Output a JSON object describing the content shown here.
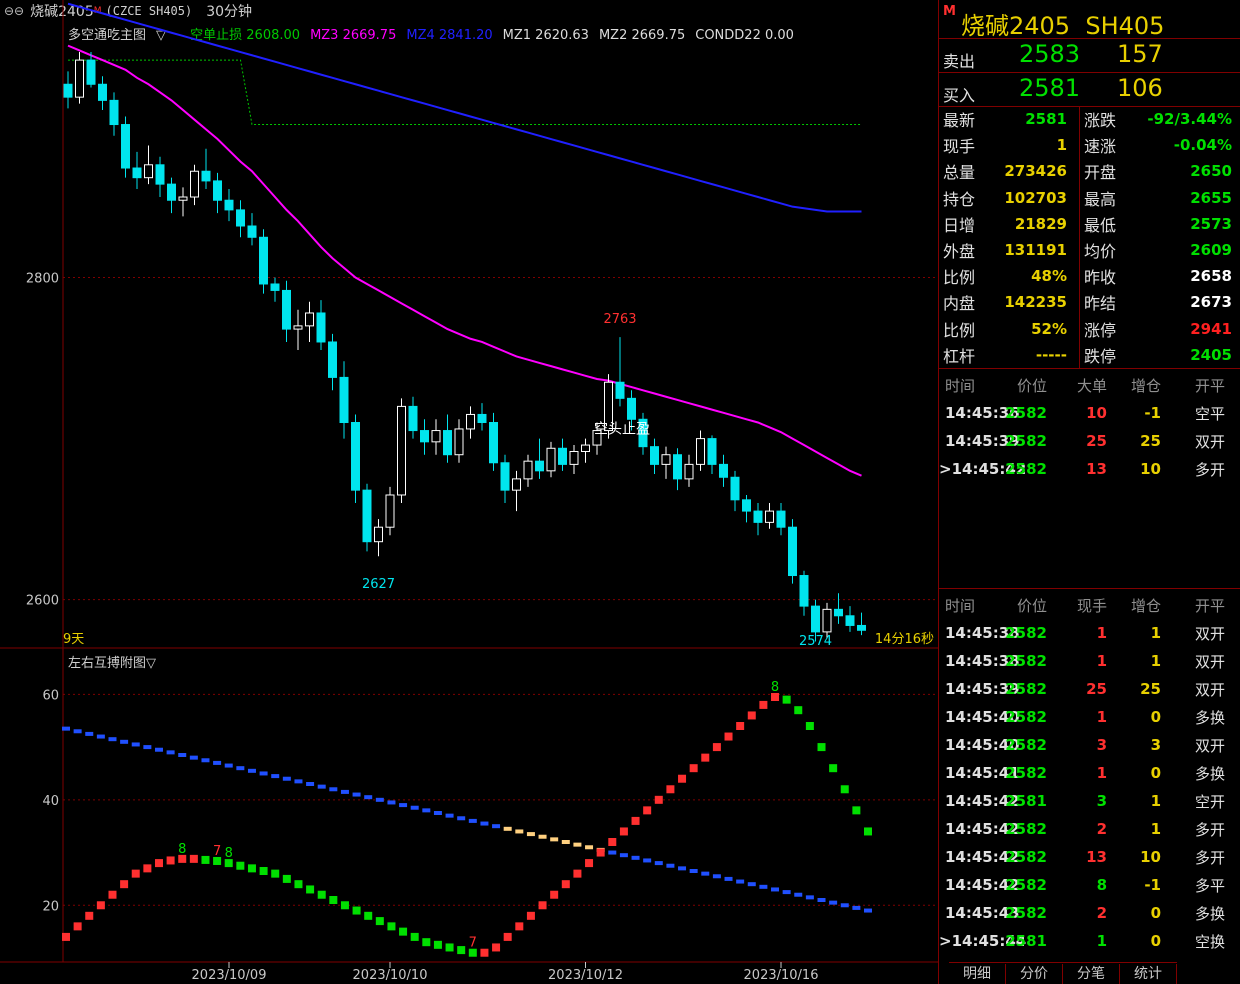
{
  "window": {
    "symbol": "烧碱2405",
    "flag": "M",
    "exchange": "(CZCE SH405)",
    "period": "30分钟"
  },
  "main": {
    "indicator_name": "多空通吃主图",
    "legend": [
      {
        "text": "空单止损 2608.00",
        "color": "#00c800"
      },
      {
        "text": "MZ3 2669.75",
        "color": "#ff00ff"
      },
      {
        "text": "MZ4 2841.20",
        "color": "#2020ff"
      },
      {
        "text": "MZ1 2620.63",
        "color": "#dcdcdc"
      },
      {
        "text": "MZ2 2669.75",
        "color": "#dcdcdc"
      },
      {
        "text": "CONDD22 0.00",
        "color": "#dcdcdc"
      }
    ],
    "y_ticks": [
      "2800",
      "2600"
    ],
    "label_high": "2763",
    "label_low1": "2627",
    "label_low2": "2574",
    "signal_text": "空头止盈",
    "bottom_left": "9天",
    "bottom_right": "14分16秒"
  },
  "sub": {
    "indicator_name": "左右互搏附图",
    "y_ticks": [
      "60",
      "40",
      "20"
    ],
    "markers": [
      "8",
      "7",
      "8",
      "7",
      "8"
    ]
  },
  "x_axis": [
    "2023/10/09",
    "2023/10/10",
    "2023/10/12",
    "2023/10/16"
  ],
  "quote": {
    "title": "烧碱2405  SH405",
    "flag": "M",
    "sell_label": "卖出",
    "sell_price": "2583",
    "sell_vol": "157",
    "buy_label": "买入",
    "buy_price": "2581",
    "buy_vol": "106",
    "left": [
      {
        "label": "最新",
        "value": "2581",
        "color": "#00e000"
      },
      {
        "label": "现手",
        "value": "1",
        "color": "#e8d000"
      },
      {
        "label": "总量",
        "value": "273426",
        "color": "#e8d000"
      },
      {
        "label": "持仓",
        "value": "102703",
        "color": "#e8d000"
      },
      {
        "label": "日增",
        "value": "21829",
        "color": "#e8d000"
      },
      {
        "label": "外盘",
        "value": "131191",
        "color": "#e8d000"
      },
      {
        "label": "比例",
        "value": "48%",
        "color": "#e8d000"
      },
      {
        "label": "内盘",
        "value": "142235",
        "color": "#e8d000"
      },
      {
        "label": "比例",
        "value": "52%",
        "color": "#e8d000"
      },
      {
        "label": "杠杆",
        "value": "-----",
        "color": "#e8d000"
      }
    ],
    "right": [
      {
        "label": "涨跌",
        "value": "-92/3.44%",
        "color": "#00e000"
      },
      {
        "label": "速涨",
        "value": "-0.04%",
        "color": "#00e000"
      },
      {
        "label": "开盘",
        "value": "2650",
        "color": "#00e000"
      },
      {
        "label": "最高",
        "value": "2655",
        "color": "#00e000"
      },
      {
        "label": "最低",
        "value": "2573",
        "color": "#00e000"
      },
      {
        "label": "均价",
        "value": "2609",
        "color": "#00e000"
      },
      {
        "label": "昨收",
        "value": "2658",
        "color": "#ffffff"
      },
      {
        "label": "昨结",
        "value": "2673",
        "color": "#ffffff"
      },
      {
        "label": "涨停",
        "value": "2941",
        "color": "#ff2020"
      },
      {
        "label": "跌停",
        "value": "2405",
        "color": "#00e000"
      }
    ]
  },
  "big_trades": {
    "headers": [
      "时间",
      "价位",
      "大单",
      "增仓",
      "开平"
    ],
    "rows": [
      {
        "mark": "",
        "time": "14:45:36",
        "price": "2582",
        "vol": "10",
        "chg": "-1",
        "type": "空平"
      },
      {
        "mark": "",
        "time": "14:45:39",
        "price": "2582",
        "vol": "25",
        "chg": "25",
        "type": "双开"
      },
      {
        "mark": ">",
        "time": "14:45:42",
        "price": "2582",
        "vol": "13",
        "chg": "10",
        "type": "多开"
      }
    ]
  },
  "ticks": {
    "headers": [
      "时间",
      "价位",
      "现手",
      "增仓",
      "开平"
    ],
    "rows": [
      {
        "mark": "",
        "time": "14:45:38",
        "price": "2582",
        "vol": "1",
        "vcol": "#ff3030",
        "chg": "1",
        "type": "双开"
      },
      {
        "mark": "",
        "time": "14:45:38",
        "price": "2582",
        "vol": "1",
        "vcol": "#ff3030",
        "chg": "1",
        "type": "双开"
      },
      {
        "mark": "",
        "time": "14:45:39",
        "price": "2582",
        "vol": "25",
        "vcol": "#ff3030",
        "chg": "25",
        "type": "双开"
      },
      {
        "mark": "",
        "time": "14:45:40",
        "price": "2582",
        "vol": "1",
        "vcol": "#ff3030",
        "chg": "0",
        "type": "多换"
      },
      {
        "mark": "",
        "time": "14:45:40",
        "price": "2582",
        "vol": "3",
        "vcol": "#ff3030",
        "chg": "3",
        "type": "双开"
      },
      {
        "mark": "",
        "time": "14:45:41",
        "price": "2582",
        "vol": "1",
        "vcol": "#ff3030",
        "chg": "0",
        "type": "多换"
      },
      {
        "mark": "",
        "time": "14:45:42",
        "price": "2581",
        "vol": "3",
        "vcol": "#00e000",
        "chg": "1",
        "type": "空开"
      },
      {
        "mark": "",
        "time": "14:45:42",
        "price": "2582",
        "vol": "2",
        "vcol": "#ff3030",
        "chg": "1",
        "type": "多开"
      },
      {
        "mark": "",
        "time": "14:45:42",
        "price": "2582",
        "vol": "13",
        "vcol": "#ff3030",
        "chg": "10",
        "type": "多开"
      },
      {
        "mark": "",
        "time": "14:45:42",
        "price": "2582",
        "vol": "8",
        "vcol": "#00e000",
        "chg": "-1",
        "type": "多平"
      },
      {
        "mark": "",
        "time": "14:45:43",
        "price": "2582",
        "vol": "2",
        "vcol": "#ff3030",
        "chg": "0",
        "type": "多换"
      },
      {
        "mark": ">",
        "time": "14:45:44",
        "price": "2581",
        "vol": "1",
        "vcol": "#00e000",
        "chg": "0",
        "type": "空换"
      }
    ]
  },
  "tabs": [
    "明细",
    "分价",
    "分笔",
    "统计"
  ],
  "colors": {
    "up": "#ffffff",
    "down": "#00e5ee",
    "mz3": "#ff00ff",
    "mz4": "#2020ff",
    "stop": "#00c800",
    "grid": "#800000",
    "red": "#ff3030",
    "green": "#00e000",
    "blue": "#2050ff",
    "orange": "#ffd080"
  },
  "chart_data": [
    {
      "type": "candlestick",
      "title": "多空通吃主图",
      "ylim": [
        2570,
        2945
      ],
      "y_ticks": [
        2800,
        2600
      ],
      "candles": [
        [
          2920,
          2928,
          2905,
          2912
        ],
        [
          2912,
          2940,
          2908,
          2935
        ],
        [
          2935,
          2940,
          2918,
          2920
        ],
        [
          2920,
          2925,
          2904,
          2910
        ],
        [
          2910,
          2915,
          2888,
          2895
        ],
        [
          2895,
          2900,
          2862,
          2868
        ],
        [
          2868,
          2878,
          2855,
          2862
        ],
        [
          2862,
          2882,
          2858,
          2870
        ],
        [
          2870,
          2875,
          2850,
          2858
        ],
        [
          2858,
          2862,
          2840,
          2848
        ],
        [
          2848,
          2856,
          2838,
          2850
        ],
        [
          2850,
          2870,
          2845,
          2866
        ],
        [
          2866,
          2880,
          2855,
          2860
        ],
        [
          2860,
          2865,
          2840,
          2848
        ],
        [
          2848,
          2855,
          2835,
          2842
        ],
        [
          2842,
          2848,
          2825,
          2832
        ],
        [
          2832,
          2840,
          2820,
          2825
        ],
        [
          2825,
          2830,
          2790,
          2796
        ],
        [
          2796,
          2800,
          2785,
          2792
        ],
        [
          2792,
          2798,
          2760,
          2768
        ],
        [
          2768,
          2780,
          2755,
          2770
        ],
        [
          2770,
          2785,
          2760,
          2778
        ],
        [
          2778,
          2786,
          2755,
          2760
        ],
        [
          2760,
          2765,
          2730,
          2738
        ],
        [
          2738,
          2748,
          2700,
          2710
        ],
        [
          2710,
          2715,
          2660,
          2668
        ],
        [
          2668,
          2672,
          2630,
          2636
        ],
        [
          2636,
          2650,
          2627,
          2645
        ],
        [
          2645,
          2670,
          2640,
          2665
        ],
        [
          2665,
          2725,
          2660,
          2720
        ],
        [
          2720,
          2726,
          2700,
          2705
        ],
        [
          2705,
          2712,
          2690,
          2698
        ],
        [
          2698,
          2712,
          2690,
          2705
        ],
        [
          2705,
          2715,
          2685,
          2690
        ],
        [
          2690,
          2712,
          2685,
          2706
        ],
        [
          2706,
          2720,
          2700,
          2715
        ],
        [
          2715,
          2722,
          2705,
          2710
        ],
        [
          2710,
          2716,
          2680,
          2685
        ],
        [
          2685,
          2690,
          2660,
          2668
        ],
        [
          2668,
          2680,
          2655,
          2675
        ],
        [
          2675,
          2690,
          2670,
          2686
        ],
        [
          2686,
          2700,
          2675,
          2680
        ],
        [
          2680,
          2698,
          2676,
          2694
        ],
        [
          2694,
          2700,
          2680,
          2684
        ],
        [
          2684,
          2696,
          2678,
          2692
        ],
        [
          2692,
          2700,
          2685,
          2696
        ],
        [
          2696,
          2710,
          2690,
          2705
        ],
        [
          2705,
          2740,
          2700,
          2735
        ],
        [
          2735,
          2763,
          2720,
          2725
        ],
        [
          2725,
          2730,
          2705,
          2712
        ],
        [
          2712,
          2716,
          2690,
          2695
        ],
        [
          2695,
          2700,
          2678,
          2684
        ],
        [
          2684,
          2695,
          2675,
          2690
        ],
        [
          2690,
          2694,
          2668,
          2675
        ],
        [
          2675,
          2690,
          2670,
          2684
        ],
        [
          2684,
          2705,
          2680,
          2700
        ],
        [
          2700,
          2702,
          2678,
          2684
        ],
        [
          2684,
          2690,
          2670,
          2676
        ],
        [
          2676,
          2680,
          2655,
          2662
        ],
        [
          2662,
          2665,
          2648,
          2655
        ],
        [
          2655,
          2660,
          2640,
          2648
        ],
        [
          2648,
          2660,
          2644,
          2655
        ],
        [
          2655,
          2660,
          2640,
          2645
        ],
        [
          2645,
          2650,
          2610,
          2615
        ],
        [
          2615,
          2618,
          2590,
          2596
        ],
        [
          2596,
          2600,
          2574,
          2580
        ],
        [
          2580,
          2598,
          2576,
          2594
        ],
        [
          2594,
          2604,
          2585,
          2590
        ],
        [
          2590,
          2596,
          2580,
          2584
        ],
        [
          2584,
          2592,
          2578,
          2581
        ]
      ],
      "series": [
        {
          "name": "MZ3",
          "values": [
            2944,
            2941,
            2938,
            2935,
            2932,
            2929,
            2924,
            2920,
            2915,
            2910,
            2904,
            2898,
            2892,
            2886,
            2879,
            2872,
            2866,
            2858,
            2850,
            2842,
            2835,
            2827,
            2819,
            2812,
            2806,
            2800,
            2796,
            2792,
            2788,
            2784,
            2780,
            2776,
            2772,
            2768,
            2765,
            2762,
            2760,
            2757,
            2754,
            2751,
            2749,
            2747,
            2745,
            2743,
            2741,
            2739,
            2737,
            2736,
            2734,
            2732,
            2730,
            2728,
            2726,
            2724,
            2722,
            2720,
            2718,
            2716,
            2714,
            2712,
            2710,
            2707,
            2704,
            2700,
            2696,
            2692,
            2688,
            2684,
            2680,
            2677
          ]
        },
        {
          "name": "MZ4",
          "values": [
            2970,
            2968,
            2966,
            2964,
            2962,
            2960,
            2958,
            2956,
            2954,
            2952,
            2950,
            2948,
            2946,
            2944,
            2942,
            2940,
            2938,
            2936,
            2934,
            2932,
            2930,
            2928,
            2926,
            2924,
            2922,
            2920,
            2918,
            2916,
            2914,
            2912,
            2910,
            2908,
            2906,
            2904,
            2902,
            2900,
            2898,
            2896,
            2894,
            2892,
            2890,
            2888,
            2886,
            2884,
            2882,
            2880,
            2878,
            2876,
            2874,
            2872,
            2870,
            2868,
            2866,
            2864,
            2862,
            2860,
            2858,
            2856,
            2854,
            2852,
            2850,
            2848,
            2846,
            2844,
            2843,
            2842,
            2841,
            2841,
            2841,
            2841
          ]
        },
        {
          "name": "空单止损",
          "values": [
            2935,
            2935,
            2935,
            2935,
            2935,
            2935,
            2935,
            2935,
            2935,
            2935,
            2935,
            2935,
            2935,
            2935,
            2935,
            2935,
            2895,
            2895,
            2895,
            2895,
            2895,
            2895,
            2895,
            2895,
            2895,
            2895,
            2895,
            2895,
            2895,
            2895,
            2895,
            2895,
            2895,
            2895,
            2895,
            2895,
            2895,
            2895,
            2895,
            2895,
            2895,
            2895,
            2895,
            2895,
            2895,
            2895,
            2895,
            2895,
            2895,
            2895,
            2895,
            2895,
            2895,
            2895,
            2895,
            2895,
            2895,
            2895,
            2895,
            2895,
            2895,
            2895,
            2895,
            2895,
            2895,
            2895,
            2895,
            2895,
            2895,
            2895
          ]
        }
      ]
    },
    {
      "type": "line",
      "title": "左右互搏附图",
      "ylim": [
        10,
        65
      ],
      "y_ticks": [
        60,
        40,
        20
      ],
      "series": [
        {
          "name": "",
          "values": [
            53.5,
            53,
            52.5,
            52,
            51.5,
            51,
            50.5,
            50,
            49.5,
            49,
            48.5,
            48,
            47.5,
            47,
            46.5,
            46,
            45.5,
            45,
            44.5,
            44,
            43.5,
            43,
            42.5,
            42,
            41.5,
            41,
            40.5,
            40,
            39.5,
            39,
            38.5,
            38,
            37.5,
            37,
            36.5,
            36,
            35.5,
            35,
            34.5,
            34,
            33.5,
            33,
            32.5,
            32,
            31.5,
            31,
            30.5,
            30,
            29.5,
            29,
            28.5,
            28,
            27.5,
            27,
            26.5,
            26,
            25.5,
            25,
            24.5,
            24,
            23.5,
            23,
            22.5,
            22,
            21.5,
            21,
            20.5,
            20,
            19.5,
            19
          ]
        },
        {
          "name": "",
          "values": [
            14,
            16,
            18,
            20,
            22,
            24,
            26,
            27,
            28,
            28.5,
            28.8,
            28.8,
            28.6,
            28.4,
            28,
            27.5,
            27,
            26.5,
            26,
            25,
            24,
            23,
            22,
            21,
            20,
            19,
            18,
            17,
            16,
            15,
            14,
            13,
            12.5,
            12,
            11.5,
            11,
            11,
            12,
            14,
            16,
            18,
            20,
            22,
            24,
            26,
            28,
            30,
            32,
            34,
            36,
            38,
            40,
            42,
            44,
            46,
            48,
            50,
            52,
            54,
            56,
            58,
            59.5,
            59,
            57,
            54,
            50,
            46,
            42,
            38,
            34
          ]
        }
      ]
    }
  ]
}
